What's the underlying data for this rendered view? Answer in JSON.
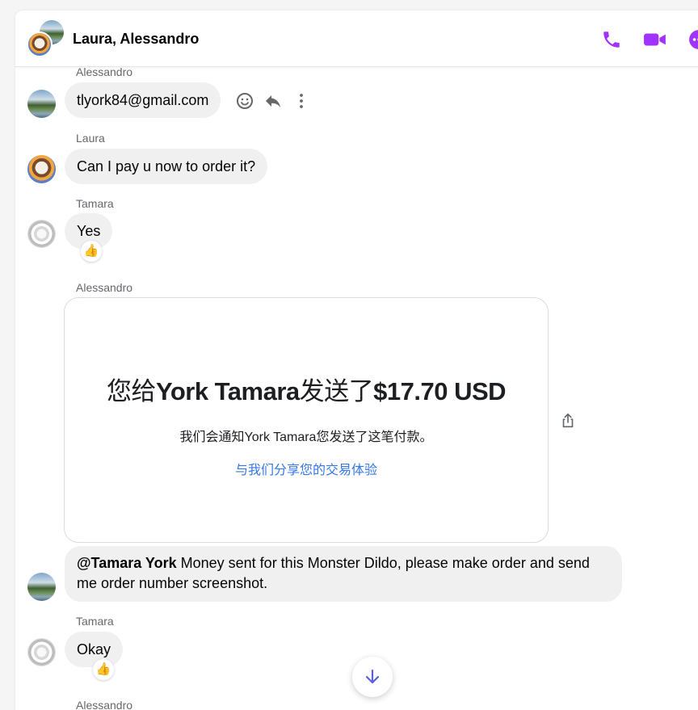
{
  "header": {
    "title": "Laura, Alessandro",
    "icons": [
      "phone-icon",
      "video-icon",
      "more-icon"
    ],
    "accent": "#a033ff"
  },
  "messages": [
    {
      "sender": "Alessandro",
      "text": "tlyork84@gmail.com",
      "avatar": "lake-avatar"
    },
    {
      "sender": "Laura",
      "text": "Can I pay u now to order it?",
      "avatar": "dog-avatar"
    },
    {
      "sender": "Tamara",
      "text": "Yes",
      "avatar": "cat-avatar",
      "reaction": "👍"
    },
    {
      "sender": "Alessandro"
    },
    {
      "mention": "@Tamara York",
      "text": "Money sent for this Monster Dildo, please make order and send me order number screenshot.",
      "avatar": "lake-avatar"
    },
    {
      "sender": "Tamara",
      "text": "Okay",
      "avatar": "cat-avatar",
      "reaction": "👍"
    },
    {
      "sender": "Alessandro"
    }
  ],
  "payment_card": {
    "prefix": "您给",
    "recipient": "York Tamara",
    "middle": "发送了",
    "amount": "$17.70 USD",
    "subtitle": "我们会通知York Tamara您发送了这笔付款。",
    "link": "与我们分享您的交易体验"
  },
  "hover_actions": [
    "emoji-icon",
    "reply-icon",
    "more-vertical-icon"
  ],
  "scroll_button_icon": "arrow-down-icon"
}
